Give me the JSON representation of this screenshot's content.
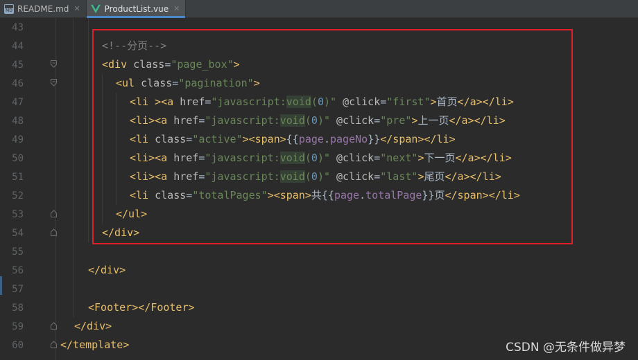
{
  "tabs": [
    {
      "label": "README.md",
      "icon": "markdown-file-icon",
      "active": false
    },
    {
      "label": "ProductList.vue",
      "icon": "vue-file-icon",
      "active": true
    }
  ],
  "line_numbers": [
    "43",
    "44",
    "45",
    "46",
    "47",
    "48",
    "49",
    "50",
    "51",
    "52",
    "53",
    "54",
    "55",
    "56",
    "57",
    "58",
    "59",
    "60"
  ],
  "code_lines": [
    "",
    "<!--分页-->",
    "<div class=\"page_box\">",
    "<ul class=\"pagination\">",
    "<li ><a href=\"javascript:void(0)\" @click=\"first\">首页</a></li>",
    "<li><a href=\"javascript:void(0)\" @click=\"pre\">上一页</a></li>",
    "<li class=\"active\"><span>{{page.pageNo}}</span></li>",
    "<li><a href=\"javascript:void(0)\" @click=\"next\">下一页</a></li>",
    "<li><a href=\"javascript:void(0)\" @click=\"last\">尾页</a></li>",
    "<li class=\"totalPages\"><span>共{{page.totalPage}}页</span></li>",
    "</ul>",
    "</div>",
    "",
    "</div>",
    "",
    "<Footer></Footer>",
    "</div>",
    "</template>"
  ],
  "watermark": "CSDN @无条件做异梦",
  "colors": {
    "background": "#2b2b2b",
    "tag": "#e8bf6a",
    "attribute": "#bababa",
    "string": "#6a8759",
    "variable": "#9876aa",
    "number": "#6897bb",
    "comment": "#808080",
    "highlight_box": "#e01e28"
  }
}
